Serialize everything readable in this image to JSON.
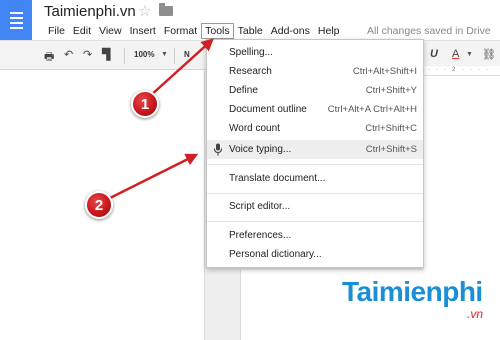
{
  "header": {
    "doc_title": "Taimienphi.vn",
    "save_status": "All changes saved in Drive"
  },
  "menubar": {
    "items": [
      "File",
      "Edit",
      "View",
      "Insert",
      "Format",
      "Tools",
      "Table",
      "Add-ons",
      "Help"
    ],
    "active": "Tools"
  },
  "toolbar": {
    "zoom": "100%",
    "font_partial": "N",
    "ruler_mark": "2"
  },
  "tools_menu": {
    "items": [
      {
        "label": "Spelling...",
        "shortcut": ""
      },
      {
        "label": "Research",
        "shortcut": "Ctrl+Alt+Shift+I"
      },
      {
        "label": "Define",
        "shortcut": "Ctrl+Shift+Y"
      },
      {
        "label": "Document outline",
        "shortcut": "Ctrl+Alt+A Ctrl+Alt+H"
      },
      {
        "label": "Word count",
        "shortcut": "Ctrl+Shift+C"
      },
      {
        "label": "Voice typing...",
        "shortcut": "Ctrl+Shift+S",
        "highlighted": true,
        "icon": "microphone-icon"
      },
      {
        "label": "Translate document...",
        "shortcut": ""
      },
      {
        "label": "Script editor...",
        "shortcut": ""
      },
      {
        "label": "Preferences...",
        "shortcut": ""
      },
      {
        "label": "Personal dictionary...",
        "shortcut": ""
      }
    ]
  },
  "annotations": {
    "badge1": "1",
    "badge2": "2",
    "color": "#d11f24"
  },
  "watermark": {
    "main": "Taimienphi",
    "sub": ".vn"
  },
  "colors": {
    "docs_blue": "#4285f4",
    "watermark_blue": "#1b8fd6",
    "highlight": "#eeeeee"
  }
}
